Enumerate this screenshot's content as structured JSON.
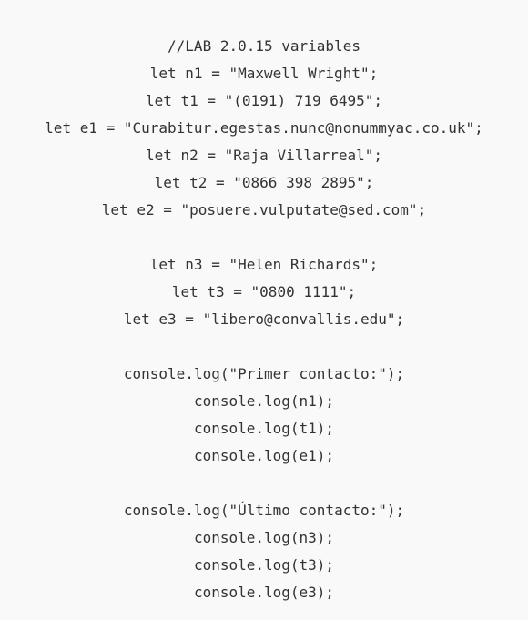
{
  "code": {
    "comment": "//LAB 2.0.15 variables",
    "n1": "let n1 = \"Maxwell Wright\";",
    "t1": "let t1 = \"(0191) 719 6495\";",
    "e1": "let e1 = \"Curabitur.egestas.nunc@nonummyac.co.uk\";",
    "n2": "let n2 = \"Raja Villarreal\";",
    "t2": "let t2 = \"0866 398 2895\";",
    "e2": "let e2 = \"posuere.vulputate@sed.com\";",
    "n3": "let n3 = \"Helen Richards\";",
    "t3": "let t3 = \"0800 1111\";",
    "e3": "let e3 = \"libero@convallis.edu\";",
    "log_primer": "console.log(\"Primer contacto:\");",
    "log_n1": "console.log(n1);",
    "log_t1": "console.log(t1);",
    "log_e1": "console.log(e1);",
    "log_ultimo": "console.log(\"Último contacto:\");",
    "log_n3": "console.log(n3);",
    "log_t3": "console.log(t3);",
    "log_e3": "console.log(e3);"
  }
}
